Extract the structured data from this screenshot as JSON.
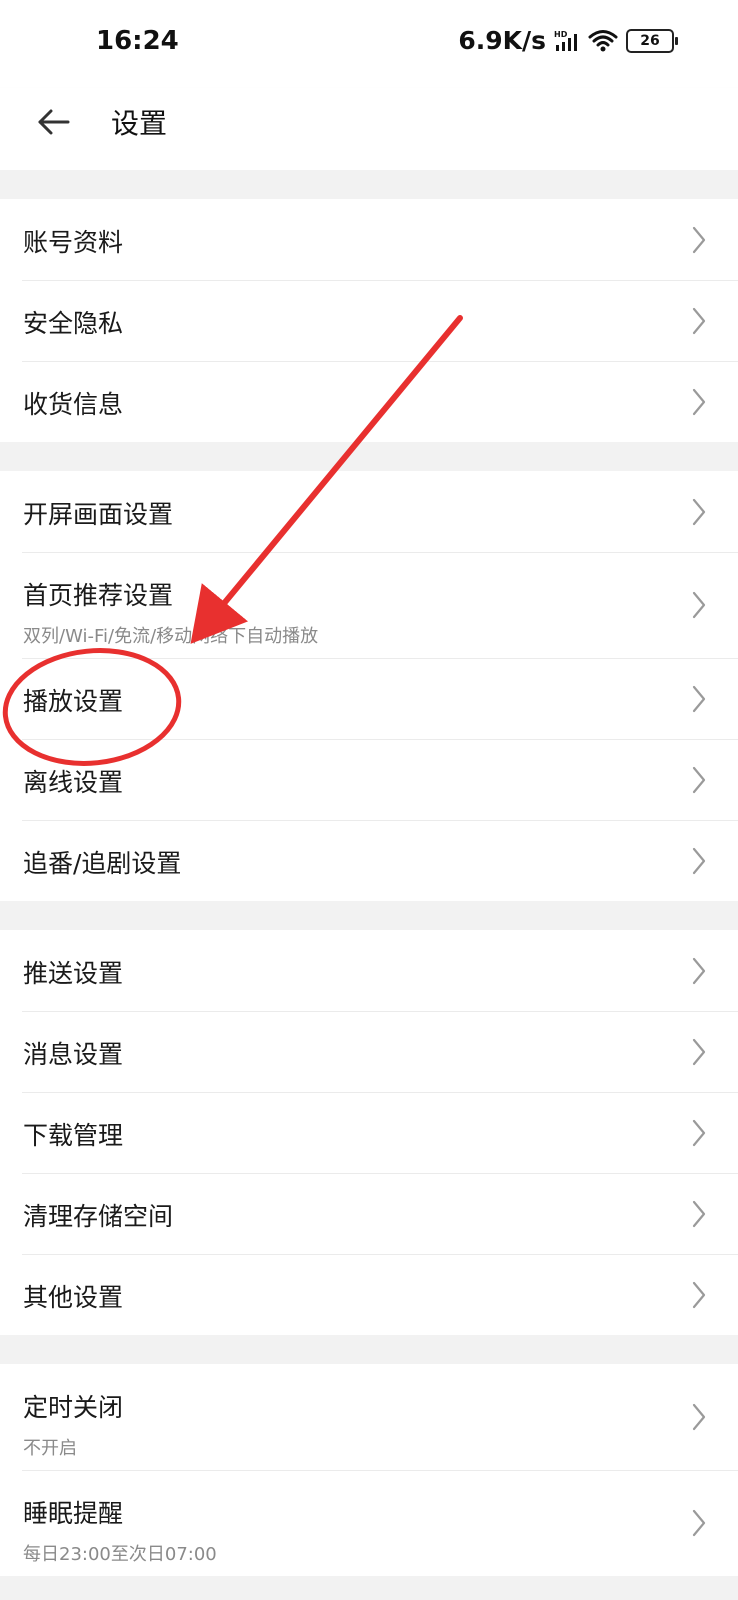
{
  "status_bar": {
    "time": "16:24",
    "net_speed": "6.9K/s",
    "battery": "26"
  },
  "header": {
    "title": "设置"
  },
  "groups": [
    {
      "items": [
        {
          "label": "账号资料"
        },
        {
          "label": "安全隐私"
        },
        {
          "label": "收货信息"
        }
      ]
    },
    {
      "items": [
        {
          "label": "开屏画面设置"
        },
        {
          "label": "首页推荐设置",
          "sub": "双列/Wi-Fi/免流/移动网络下自动播放"
        },
        {
          "label": "播放设置"
        },
        {
          "label": "离线设置"
        },
        {
          "label": "追番/追剧设置"
        }
      ]
    },
    {
      "items": [
        {
          "label": "推送设置"
        },
        {
          "label": "消息设置"
        },
        {
          "label": "下载管理"
        },
        {
          "label": "清理存储空间"
        },
        {
          "label": "其他设置"
        }
      ]
    },
    {
      "items": [
        {
          "label": "定时关闭",
          "sub": "不开启"
        },
        {
          "label": "睡眠提醒",
          "sub": "每日23:00至次日07:00"
        }
      ]
    }
  ],
  "colors": {
    "annotation_red": "#e8302f",
    "background": "#f2f2f2"
  }
}
